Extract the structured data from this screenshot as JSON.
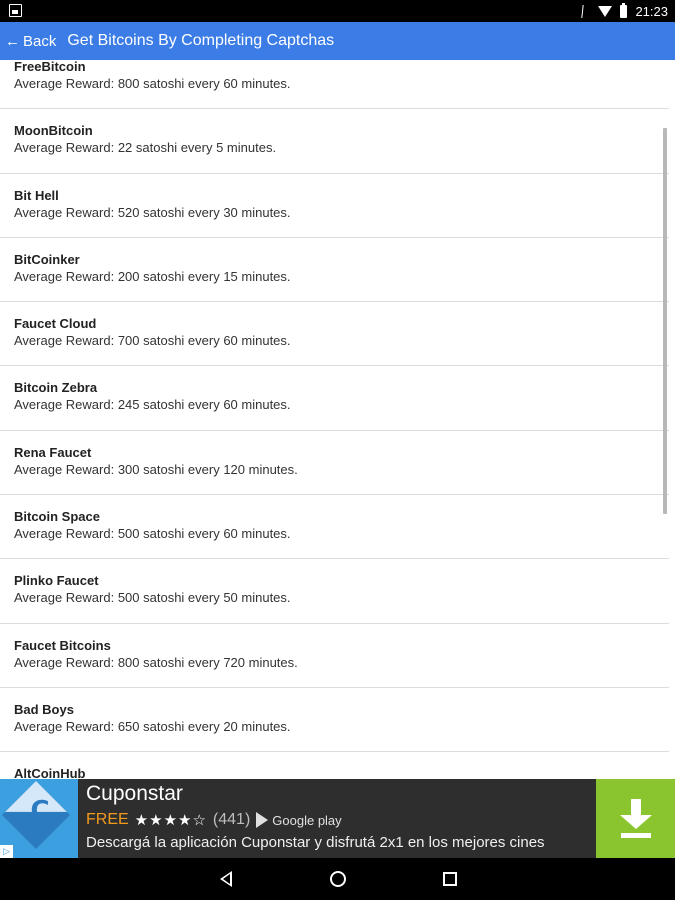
{
  "status_bar": {
    "time": "21:23"
  },
  "app_bar": {
    "back_label": "Back",
    "back_arrow": "←",
    "title": "Get Bitcoins By Completing Captchas"
  },
  "list": {
    "items": [
      {
        "name": "FreeBitcoin",
        "reward": "Average Reward: 800 satoshi every 60 minutes."
      },
      {
        "name": "MoonBitcoin",
        "reward": "Average Reward: 22 satoshi every 5 minutes."
      },
      {
        "name": "Bit Hell",
        "reward": "Average Reward: 520 satoshi every 30 minutes."
      },
      {
        "name": "BitCoinker",
        "reward": "Average Reward: 200 satoshi every 15 minutes."
      },
      {
        "name": "Faucet Cloud",
        "reward": "Average Reward: 700 satoshi every 60 minutes."
      },
      {
        "name": "Bitcoin Zebra",
        "reward": "Average Reward: 245 satoshi every 60 minutes."
      },
      {
        "name": "Rena Faucet",
        "reward": "Average Reward: 300 satoshi every 120 minutes."
      },
      {
        "name": "Bitcoin Space",
        "reward": "Average Reward: 500 satoshi every 60 minutes."
      },
      {
        "name": "Plinko Faucet",
        "reward": "Average Reward: 500 satoshi every 50 minutes."
      },
      {
        "name": "Faucet Bitcoins",
        "reward": "Average Reward: 800 satoshi every 720 minutes."
      },
      {
        "name": "Bad Boys",
        "reward": "Average Reward: 650 satoshi every 20 minutes."
      },
      {
        "name": "AltCoinHub",
        "reward": ""
      }
    ]
  },
  "ad": {
    "title": "Cuponstar",
    "free_label": "FREE",
    "stars": "★★★★☆",
    "rating_count": "(441)",
    "store_label": "Google play",
    "description": "Descargá la aplicación Cuponstar y disfrutá 2x1 en los mejores cines",
    "logo_letter": "C",
    "choices_label": "▷"
  },
  "colors": {
    "app_bar": "#3b7ce6",
    "ad_free": "#f39a1c",
    "ad_download": "#8ac530"
  }
}
